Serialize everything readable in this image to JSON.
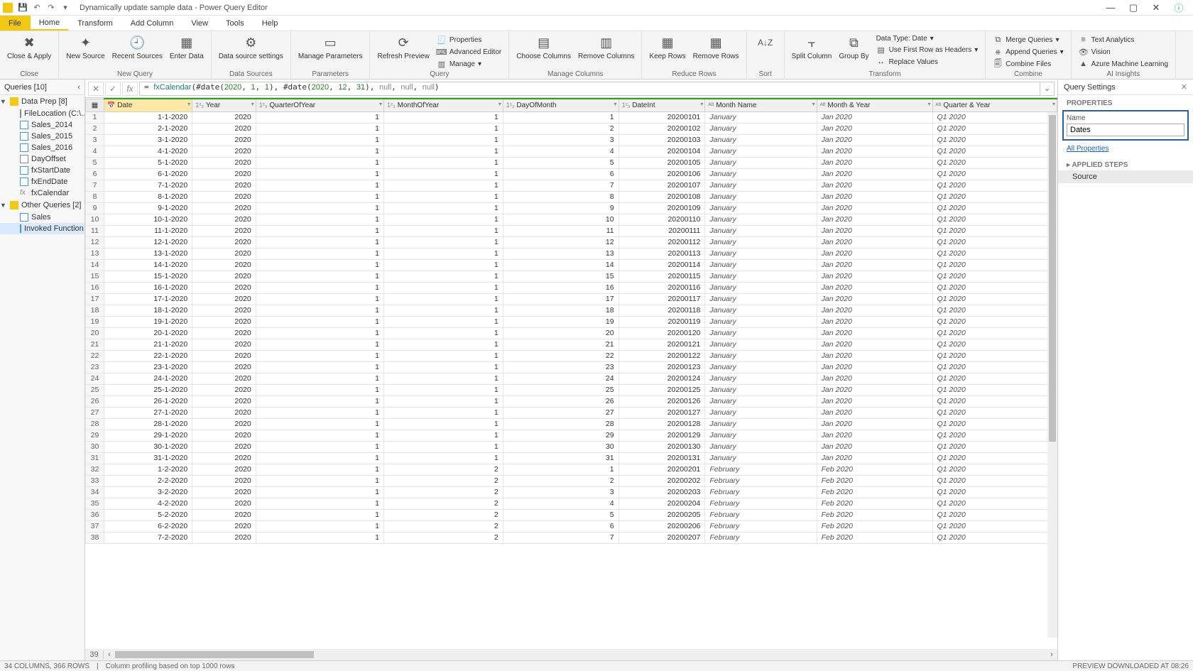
{
  "titleBar": {
    "title": "Dynamically update sample data - Power Query Editor",
    "minimize": "—",
    "maximize": "▢",
    "close": "✕"
  },
  "menuTabs": [
    "File",
    "Home",
    "Transform",
    "Add Column",
    "View",
    "Tools",
    "Help"
  ],
  "ribbon": {
    "close": {
      "closeApply": "Close &\nApply"
    },
    "newQuery": {
      "newSource": "New\nSource",
      "recentSources": "Recent\nSources",
      "enterData": "Enter\nData",
      "label": "New Query"
    },
    "dataSources": {
      "dsSettings": "Data source\nsettings",
      "label": "Data Sources"
    },
    "parameters": {
      "manageParams": "Manage\nParameters",
      "label": "Parameters"
    },
    "query": {
      "refresh": "Refresh\nPreview",
      "properties": "Properties",
      "advancedEditor": "Advanced Editor",
      "manage": "Manage",
      "label": "Query"
    },
    "manageColumns": {
      "choose": "Choose\nColumns",
      "remove": "Remove\nColumns",
      "label": "Manage Columns"
    },
    "reduceRows": {
      "keep": "Keep\nRows",
      "remove": "Remove\nRows",
      "label": "Reduce Rows"
    },
    "sort": {
      "label": "Sort"
    },
    "transform": {
      "split": "Split\nColumn",
      "group": "Group\nBy",
      "dataType": "Data Type: Date",
      "firstRow": "Use First Row as Headers",
      "replace": "Replace Values",
      "label": "Transform"
    },
    "combine": {
      "merge": "Merge Queries",
      "append": "Append Queries",
      "combineFiles": "Combine Files",
      "label": "Combine"
    },
    "ai": {
      "textAnalytics": "Text Analytics",
      "vision": "Vision",
      "aml": "Azure Machine Learning",
      "label": "AI Insights"
    }
  },
  "queriesPane": {
    "header": "Queries [10]",
    "groups": [
      {
        "label": "Data Prep [8]",
        "items": [
          "FileLocation (C:\\...",
          "Sales_2014",
          "Sales_2015",
          "Sales_2016",
          "DayOffset",
          "fxStartDate",
          "fxEndDate",
          "fxCalendar"
        ],
        "types": [
          "param",
          "table",
          "table",
          "table",
          "param",
          "table",
          "table",
          "fx"
        ]
      },
      {
        "label": "Other Queries [2]",
        "items": [
          "Sales",
          "Invoked Function"
        ],
        "types": [
          "table",
          "table"
        ]
      }
    ]
  },
  "formulaBar": {
    "fn": "fxCalendar",
    "args": "(#date(2020, 1, 1), #date(2020, 12, 31), null, null, null)"
  },
  "columns": [
    "Date",
    "Year",
    "QuarterOfYear",
    "MonthOfYear",
    "DayOfMonth",
    "DateInt",
    "Month Name",
    "Month & Year",
    "Quarter & Year"
  ],
  "rows": [
    [
      "1-1-2020",
      "2020",
      "1",
      "1",
      "1",
      "20200101",
      "January",
      "Jan 2020",
      "Q1 2020"
    ],
    [
      "2-1-2020",
      "2020",
      "1",
      "1",
      "2",
      "20200102",
      "January",
      "Jan 2020",
      "Q1 2020"
    ],
    [
      "3-1-2020",
      "2020",
      "1",
      "1",
      "3",
      "20200103",
      "January",
      "Jan 2020",
      "Q1 2020"
    ],
    [
      "4-1-2020",
      "2020",
      "1",
      "1",
      "4",
      "20200104",
      "January",
      "Jan 2020",
      "Q1 2020"
    ],
    [
      "5-1-2020",
      "2020",
      "1",
      "1",
      "5",
      "20200105",
      "January",
      "Jan 2020",
      "Q1 2020"
    ],
    [
      "6-1-2020",
      "2020",
      "1",
      "1",
      "6",
      "20200106",
      "January",
      "Jan 2020",
      "Q1 2020"
    ],
    [
      "7-1-2020",
      "2020",
      "1",
      "1",
      "7",
      "20200107",
      "January",
      "Jan 2020",
      "Q1 2020"
    ],
    [
      "8-1-2020",
      "2020",
      "1",
      "1",
      "8",
      "20200108",
      "January",
      "Jan 2020",
      "Q1 2020"
    ],
    [
      "9-1-2020",
      "2020",
      "1",
      "1",
      "9",
      "20200109",
      "January",
      "Jan 2020",
      "Q1 2020"
    ],
    [
      "10-1-2020",
      "2020",
      "1",
      "1",
      "10",
      "20200110",
      "January",
      "Jan 2020",
      "Q1 2020"
    ],
    [
      "11-1-2020",
      "2020",
      "1",
      "1",
      "11",
      "20200111",
      "January",
      "Jan 2020",
      "Q1 2020"
    ],
    [
      "12-1-2020",
      "2020",
      "1",
      "1",
      "12",
      "20200112",
      "January",
      "Jan 2020",
      "Q1 2020"
    ],
    [
      "13-1-2020",
      "2020",
      "1",
      "1",
      "13",
      "20200113",
      "January",
      "Jan 2020",
      "Q1 2020"
    ],
    [
      "14-1-2020",
      "2020",
      "1",
      "1",
      "14",
      "20200114",
      "January",
      "Jan 2020",
      "Q1 2020"
    ],
    [
      "15-1-2020",
      "2020",
      "1",
      "1",
      "15",
      "20200115",
      "January",
      "Jan 2020",
      "Q1 2020"
    ],
    [
      "16-1-2020",
      "2020",
      "1",
      "1",
      "16",
      "20200116",
      "January",
      "Jan 2020",
      "Q1 2020"
    ],
    [
      "17-1-2020",
      "2020",
      "1",
      "1",
      "17",
      "20200117",
      "January",
      "Jan 2020",
      "Q1 2020"
    ],
    [
      "18-1-2020",
      "2020",
      "1",
      "1",
      "18",
      "20200118",
      "January",
      "Jan 2020",
      "Q1 2020"
    ],
    [
      "19-1-2020",
      "2020",
      "1",
      "1",
      "19",
      "20200119",
      "January",
      "Jan 2020",
      "Q1 2020"
    ],
    [
      "20-1-2020",
      "2020",
      "1",
      "1",
      "20",
      "20200120",
      "January",
      "Jan 2020",
      "Q1 2020"
    ],
    [
      "21-1-2020",
      "2020",
      "1",
      "1",
      "21",
      "20200121",
      "January",
      "Jan 2020",
      "Q1 2020"
    ],
    [
      "22-1-2020",
      "2020",
      "1",
      "1",
      "22",
      "20200122",
      "January",
      "Jan 2020",
      "Q1 2020"
    ],
    [
      "23-1-2020",
      "2020",
      "1",
      "1",
      "23",
      "20200123",
      "January",
      "Jan 2020",
      "Q1 2020"
    ],
    [
      "24-1-2020",
      "2020",
      "1",
      "1",
      "24",
      "20200124",
      "January",
      "Jan 2020",
      "Q1 2020"
    ],
    [
      "25-1-2020",
      "2020",
      "1",
      "1",
      "25",
      "20200125",
      "January",
      "Jan 2020",
      "Q1 2020"
    ],
    [
      "26-1-2020",
      "2020",
      "1",
      "1",
      "26",
      "20200126",
      "January",
      "Jan 2020",
      "Q1 2020"
    ],
    [
      "27-1-2020",
      "2020",
      "1",
      "1",
      "27",
      "20200127",
      "January",
      "Jan 2020",
      "Q1 2020"
    ],
    [
      "28-1-2020",
      "2020",
      "1",
      "1",
      "28",
      "20200128",
      "January",
      "Jan 2020",
      "Q1 2020"
    ],
    [
      "29-1-2020",
      "2020",
      "1",
      "1",
      "29",
      "20200129",
      "January",
      "Jan 2020",
      "Q1 2020"
    ],
    [
      "30-1-2020",
      "2020",
      "1",
      "1",
      "30",
      "20200130",
      "January",
      "Jan 2020",
      "Q1 2020"
    ],
    [
      "31-1-2020",
      "2020",
      "1",
      "1",
      "31",
      "20200131",
      "January",
      "Jan 2020",
      "Q1 2020"
    ],
    [
      "1-2-2020",
      "2020",
      "1",
      "2",
      "1",
      "20200201",
      "February",
      "Feb 2020",
      "Q1 2020"
    ],
    [
      "2-2-2020",
      "2020",
      "1",
      "2",
      "2",
      "20200202",
      "February",
      "Feb 2020",
      "Q1 2020"
    ],
    [
      "3-2-2020",
      "2020",
      "1",
      "2",
      "3",
      "20200203",
      "February",
      "Feb 2020",
      "Q1 2020"
    ],
    [
      "4-2-2020",
      "2020",
      "1",
      "2",
      "4",
      "20200204",
      "February",
      "Feb 2020",
      "Q1 2020"
    ],
    [
      "5-2-2020",
      "2020",
      "1",
      "2",
      "5",
      "20200205",
      "February",
      "Feb 2020",
      "Q1 2020"
    ],
    [
      "6-2-2020",
      "2020",
      "1",
      "2",
      "6",
      "20200206",
      "February",
      "Feb 2020",
      "Q1 2020"
    ],
    [
      "7-2-2020",
      "2020",
      "1",
      "2",
      "7",
      "20200207",
      "February",
      "Feb 2020",
      "Q1 2020"
    ]
  ],
  "lastRowNum": "39",
  "settings": {
    "header": "Query Settings",
    "properties": "PROPERTIES",
    "nameLabel": "Name",
    "nameValue": "Dates",
    "allProperties": "All Properties",
    "appliedSteps": "APPLIED STEPS",
    "steps": [
      "Source"
    ]
  },
  "statusBar": {
    "left": "34 COLUMNS, 366 ROWS",
    "mid": "Column profiling based on top 1000 rows",
    "right": "PREVIEW DOWNLOADED AT 08:26"
  }
}
